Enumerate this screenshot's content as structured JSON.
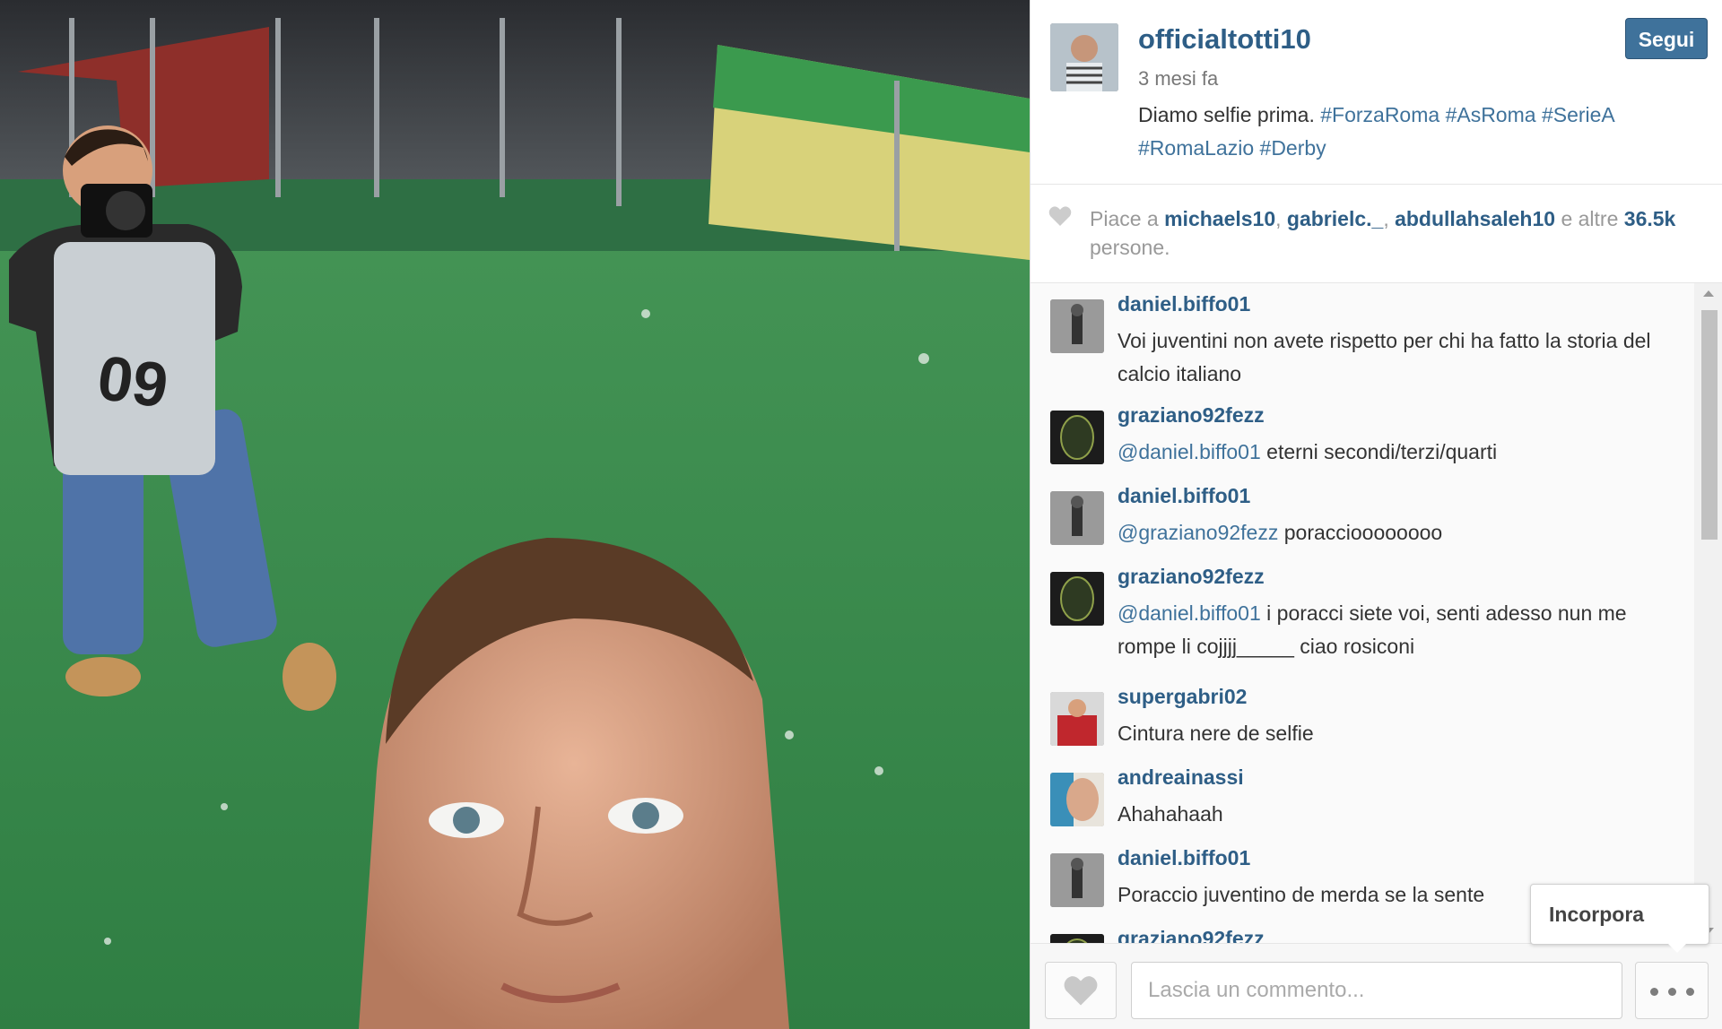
{
  "post": {
    "username": "officialtotti10",
    "follow_label": "Segui",
    "time": "3 mesi fa",
    "caption_text": "Diamo selfie prima. ",
    "caption_emoji": "",
    "hashtags": [
      "#ForzaRoma",
      "#AsRoma",
      "#SerieA",
      "#RomaLazio",
      "#Derby"
    ]
  },
  "likes": {
    "prefix": "Piace a",
    "users": [
      "michaels10",
      "gabrielc._",
      "abdullahsaleh10"
    ],
    "mid": "e altre",
    "count": "36.5k",
    "suffix": "persone."
  },
  "comments": [
    {
      "user": "daniel.biffo01",
      "mention": "",
      "text": "Voi juventini non avete rispetto per chi ha fatto la storia del calcio italiano"
    },
    {
      "user": "graziano92fezz",
      "mention": "@daniel.biffo01",
      "text": " eterni secondi/terzi/quarti"
    },
    {
      "user": "daniel.biffo01",
      "mention": "@graziano92fezz",
      "text": " poraccioooooooo"
    },
    {
      "user": "graziano92fezz",
      "mention": "@daniel.biffo01",
      "text": " i poracci siete voi, senti adesso nun me rompe li cojjjj_____ ciao  rosiconi"
    },
    {
      "user": "supergabri02",
      "mention": "",
      "text": "Cintura nere de selfie"
    },
    {
      "user": "andreainassi",
      "mention": "",
      "text": "Ahahahaah"
    },
    {
      "user": "daniel.biffo01",
      "mention": "",
      "text": "Poraccio juventino de merda se la sente"
    },
    {
      "user": "graziano92fezz",
      "mention": "",
      "text": ""
    }
  ],
  "footer": {
    "comment_placeholder": "Lascia un commento...",
    "embed_tooltip": "Incorpora"
  },
  "icons": {
    "like": "heart-icon",
    "more": "more-options-icon",
    "likes_indicator": "heart-icon"
  },
  "colors": {
    "link": "#2e5e86",
    "hashtag": "#3f729b",
    "follow_button": "#3f729b"
  }
}
